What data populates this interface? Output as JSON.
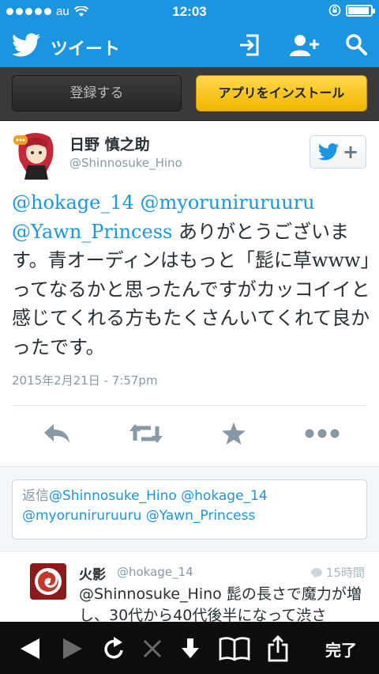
{
  "status_bar": {
    "carrier": "au",
    "time": "12:03"
  },
  "header": {
    "title": "ツイート"
  },
  "promo": {
    "register_label": "登録する",
    "install_label": "アプリをインストール"
  },
  "tweet": {
    "author_name": "日野 慎之助",
    "author_handle": "@Shinnosuke_Hino",
    "mention_1": "@hokage_14",
    "mention_2": "@myoruniruruuru",
    "mention_3": "@Yawn_Princess",
    "text_after_mentions": " ありがとうございます。青オーディンはもっと「髭に草www」ってなるかと思ったんですがカッコイイと感じてくれる方もたくさんいてくれて良かったです。",
    "timestamp": "2015年2月21日 - 7:57pm"
  },
  "reply_box": {
    "prefix": "返信",
    "mentions": "@Shinnosuke_Hino @hokage_14 @myoruniruruuru @Yawn_Princess"
  },
  "reply": {
    "name": "火影",
    "handle": "@hokage_14",
    "time": "15時間",
    "text": "@Shinnosuke_Hino 髭の長さで魔力が増し、30代から40代後半になって渋さ"
  },
  "toolbar": {
    "done_label": "完了"
  },
  "icons": {
    "bird": "twitter-bird-icon",
    "signin": "sign-in-icon",
    "add_user": "add-user-icon",
    "search": "search-icon"
  },
  "colors": {
    "twitter_blue": "#1b95e0",
    "install_yellow": "#f5bd00"
  }
}
